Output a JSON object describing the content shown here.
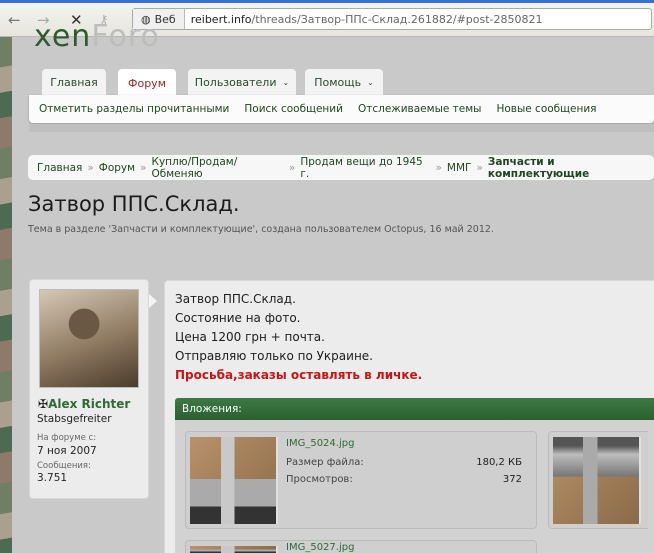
{
  "browser": {
    "back_icon": "back-arrow",
    "forward_icon": "forward-arrow",
    "stop_icon": "close",
    "key_icon": "key",
    "web_label": "Веб",
    "url_host": "reibert.info",
    "url_path": "/threads/Затвор-ППс-Склад.261882/#post-2850821"
  },
  "logo": {
    "text_a": "xen",
    "text_b": "Foro"
  },
  "tabs": [
    {
      "label": "Главная"
    },
    {
      "label": "Форум"
    },
    {
      "label": "Пользователи"
    },
    {
      "label": "Помощь"
    }
  ],
  "subnav": [
    "Отметить разделы прочитанными",
    "Поиск сообщений",
    "Отслеживаемые темы",
    "Новые сообщения"
  ],
  "breadcrumb": [
    "Главная",
    "Форум",
    "Куплю/Продам/Обменяю",
    "Продам вещи до 1945 г.",
    "ММГ",
    "Запчасти и комплектующие"
  ],
  "breadcrumb_sep": "»",
  "thread": {
    "title": "Затвор ППС.Склад.",
    "subtitle": "Тема в разделе 'Запчасти и комплектующие', создана пользователем Octopus, 16 май 2012."
  },
  "user": {
    "icon": "✠",
    "name": "Alex Richter",
    "rank": "Stabsgefreiter",
    "joined_label": "На форуме с:",
    "joined": "7 ноя 2007",
    "posts_label": "Сообщения:",
    "posts": "3.751"
  },
  "post": {
    "lines": [
      "Затвор ППС.Склад.",
      "Состояние на фото.",
      "Цена 1200 грн + почта.",
      "Отправляю только по Украине."
    ],
    "highlight": "Просьба,заказы оставлять в личке."
  },
  "attachments": {
    "header": "Вложения:",
    "size_label": "Размер файла:",
    "views_label": "Просмотров:",
    "items": [
      {
        "name": "IMG_5024.jpg",
        "size": "180,2 КБ",
        "views": "372"
      },
      {
        "name": "IMG_5027.jpg"
      }
    ]
  },
  "colors": {
    "accent": "#2f6a35",
    "red": "#c81515"
  }
}
